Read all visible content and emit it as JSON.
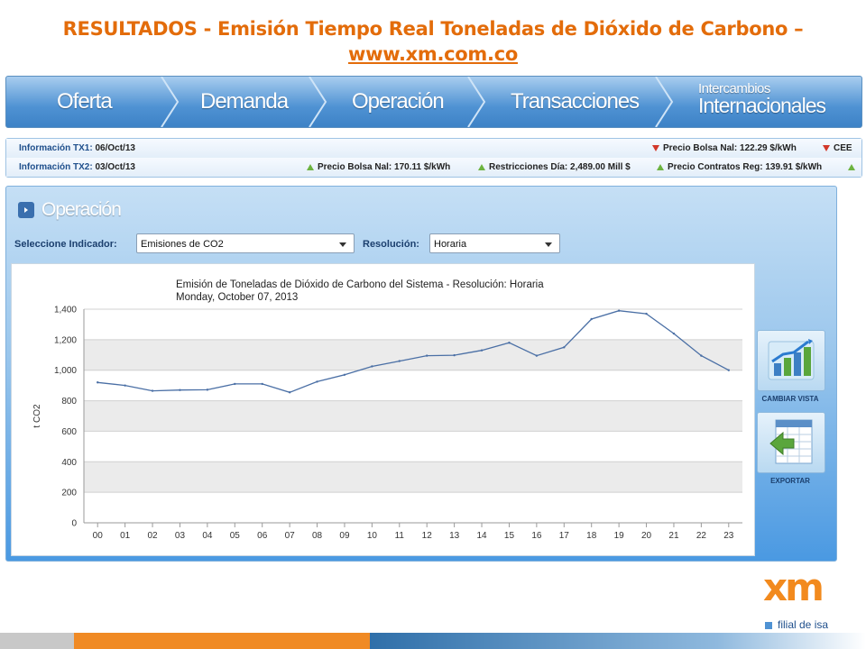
{
  "slide": {
    "title": "RESULTADOS - Emisión Tiempo Real Toneladas de Dióxido de Carbono –",
    "url": "www.xm.com.co"
  },
  "nav": {
    "items": [
      "Oferta",
      "Demanda",
      "Operación",
      "Transacciones"
    ],
    "intl_line1": "Intercambios",
    "intl_line2": "Internacionales"
  },
  "ticker": {
    "tx1_label": "Información TX1:",
    "tx1_date": "06/Oct/13",
    "tx1_price": "Precio Bolsa Nal: 122.29 $/kWh",
    "tx1_cee": "CEE",
    "tx2_label": "Información TX2:",
    "tx2_date": "03/Oct/13",
    "tx2_price": "Precio Bolsa Nal: 170.11 $/kWh",
    "tx2_restr": "Restricciones Día: 2,489.00 Mill $",
    "tx2_contract": "Precio Contratos Reg: 139.91 $/kWh"
  },
  "panel": {
    "heading": "Operación",
    "indicator_label": "Seleccione Indicador:",
    "indicator_value": "Emisiones de CO2",
    "resolution_label": "Resolución:",
    "resolution_value": "Horaria",
    "change_view": "CAMBIAR VISTA",
    "export": "EXPORTAR"
  },
  "logo": {
    "brand": "xm",
    "tagline": "filial de isa"
  },
  "colors": {
    "title_orange": "#e36c0a",
    "nav_blue": "#4f92d3",
    "line": "#4a6fa5"
  },
  "chart_data": {
    "type": "line",
    "title": "Emisión de Toneladas de Dióxido de Carbono del Sistema  - Resolución: Horaria",
    "subtitle": "Monday, October 07, 2013",
    "xlabel": "",
    "ylabel": "t CO2",
    "categories": [
      "00",
      "01",
      "02",
      "03",
      "04",
      "05",
      "06",
      "07",
      "08",
      "09",
      "10",
      "11",
      "12",
      "13",
      "14",
      "15",
      "16",
      "17",
      "18",
      "19",
      "20",
      "21",
      "22",
      "23"
    ],
    "values": [
      920,
      900,
      865,
      870,
      872,
      910,
      910,
      855,
      925,
      970,
      1025,
      1060,
      1095,
      1098,
      1130,
      1180,
      1095,
      1150,
      1335,
      1390,
      1370,
      1240,
      1095,
      1000
    ],
    "ylim": [
      0,
      1400
    ],
    "yticks": [
      "0",
      "200",
      "400",
      "600",
      "800",
      "1,000",
      "1,200",
      "1,400"
    ],
    "grid": true
  }
}
